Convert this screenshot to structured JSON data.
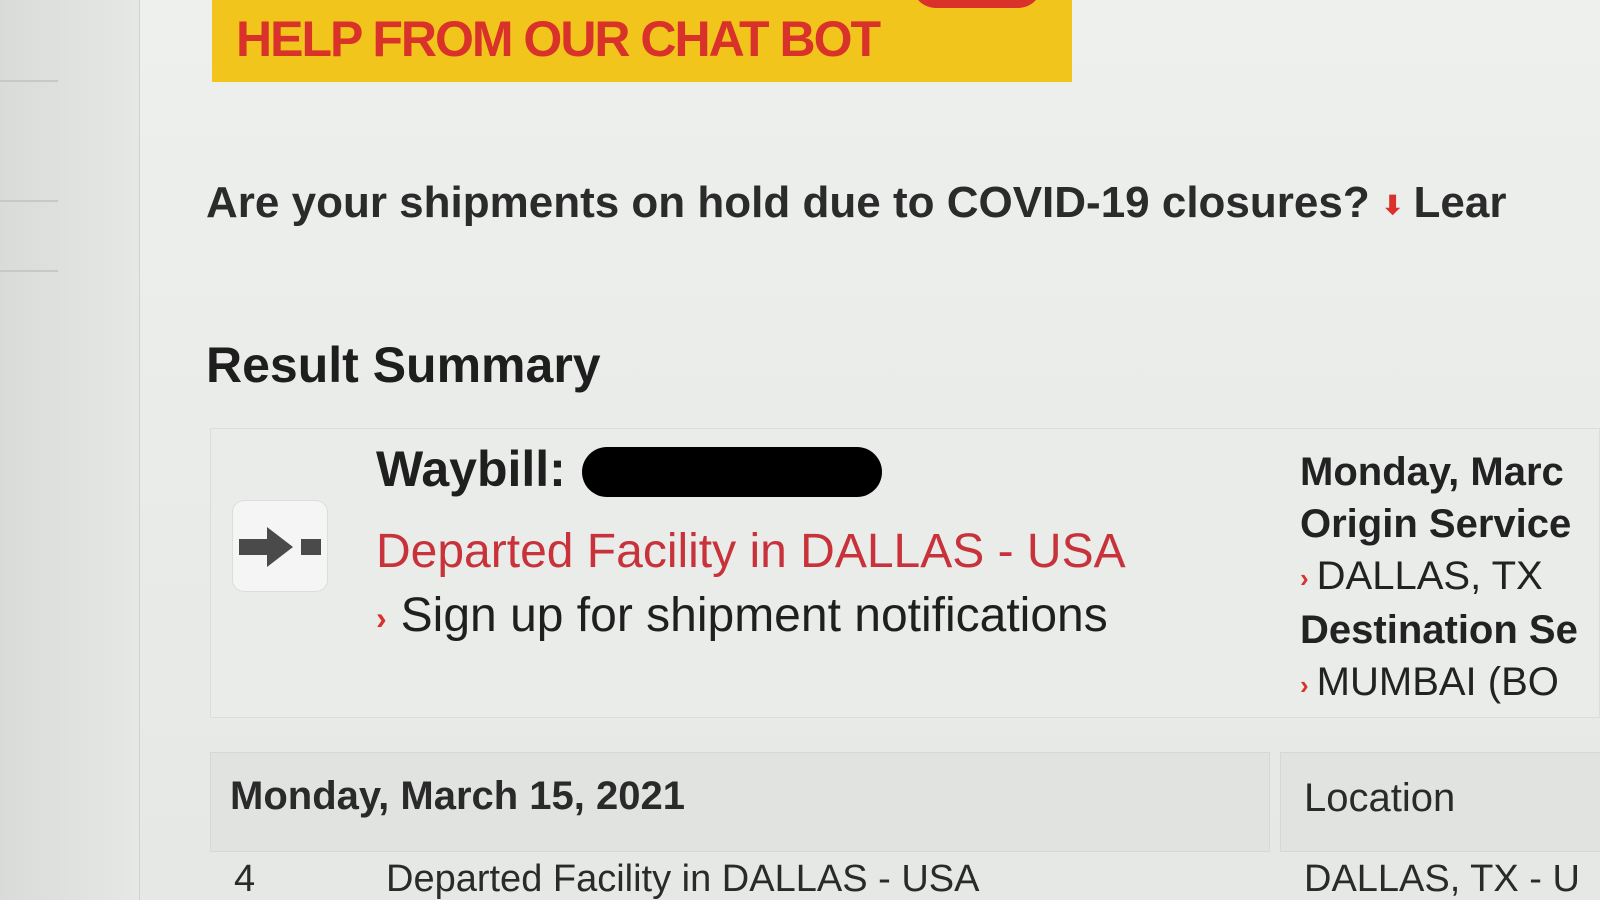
{
  "banner": {
    "text": "HELP FROM OUR CHAT BOT"
  },
  "notice": {
    "text": "Are your shipments on hold due to COVID-19 closures?",
    "link_text": "Lear"
  },
  "result": {
    "title": "Result Summary",
    "waybill_label": "Waybill:",
    "status": "Departed Facility in DALLAS - USA",
    "notifications_link": "Sign up for shipment notifications"
  },
  "right_info": {
    "date": "Monday, Marc",
    "origin_label": "Origin Service",
    "origin_value": "DALLAS, TX",
    "destination_label": "Destination Se",
    "destination_value": "MUMBAI (BO"
  },
  "table": {
    "date_header": "Monday, March 15, 2021",
    "location_header": "Location",
    "rows": [
      {
        "num": "4",
        "description": "Departed Facility in DALLAS - USA",
        "location": "DALLAS, TX - U"
      }
    ]
  },
  "colors": {
    "brand_red": "#d8322a",
    "banner_yellow": "#f2c51c"
  }
}
